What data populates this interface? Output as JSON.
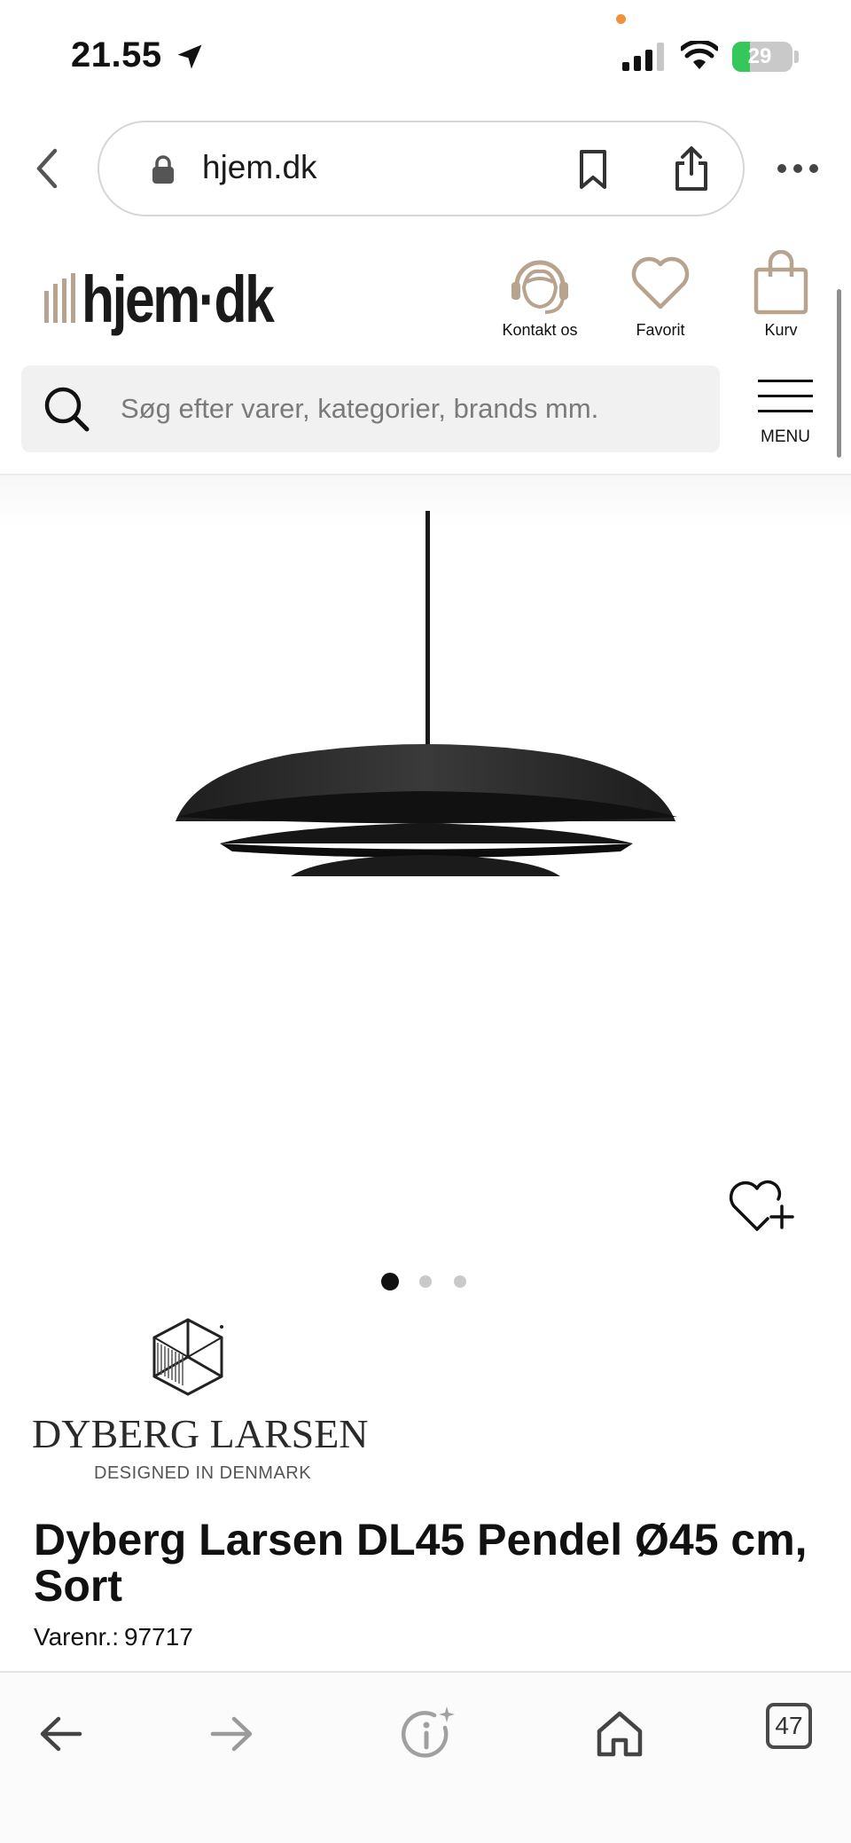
{
  "status_bar": {
    "time": "21.55",
    "battery_level": "29",
    "battery_fraction": 0.29
  },
  "browser": {
    "url": "hjem.dk",
    "open_tabs_count": "47"
  },
  "site": {
    "logo_text": "hjem·dk",
    "header_actions": {
      "contact_label": "Kontakt os",
      "favorite_label": "Favorit",
      "cart_label": "Kurv"
    },
    "search_placeholder": "Søg efter varer, kategorier, brands mm.",
    "menu_label": "MENU",
    "accent_color": "#b8a48e"
  },
  "product": {
    "carousel": {
      "count": 3,
      "active_index": 0
    },
    "brand": {
      "name": "DYBERG LARSEN",
      "tagline": "DESIGNED IN DENMARK"
    },
    "title": "Dyberg Larsen DL45 Pendel Ø45 cm, Sort",
    "sku_label": "Varenr.:",
    "sku": "97717"
  },
  "icons": {
    "status": [
      "location-arrow-icon",
      "signal-icon",
      "wifi-icon",
      "battery-icon"
    ],
    "browser": [
      "back-chevron-icon",
      "lock-icon",
      "bookmark-icon",
      "share-icon",
      "more-icon"
    ],
    "header": [
      "headset-icon",
      "heart-icon",
      "shopping-bag-icon",
      "search-icon",
      "hamburger-icon"
    ],
    "product": [
      "wishlist-add-icon"
    ],
    "toolbar": [
      "arrow-left-icon",
      "arrow-right-icon",
      "info-sparkle-icon",
      "home-icon",
      "tabs-icon"
    ]
  }
}
